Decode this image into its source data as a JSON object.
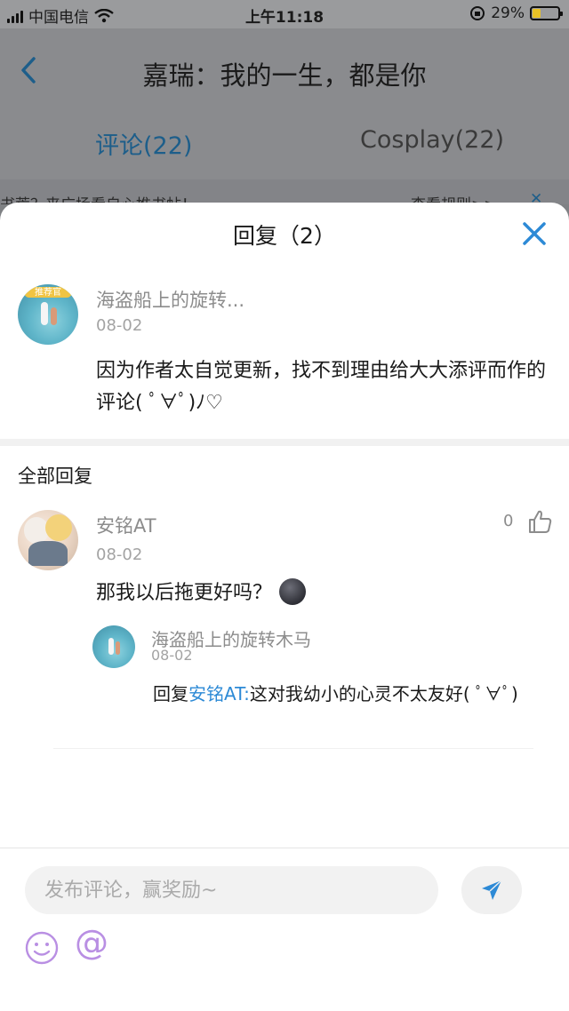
{
  "status_bar": {
    "carrier": "中国电信",
    "time": "上午11:18",
    "battery": "29%",
    "battery_level": 0.29
  },
  "header": {
    "title": "嘉瑞：我的一生，都是你"
  },
  "tabs": [
    {
      "label": "评论(22)",
      "active": true
    },
    {
      "label": "Cosplay(22)",
      "active": false
    }
  ],
  "banner": {
    "left_text": "书荒？来广场看自心推书帖！",
    "right_text": "查看规则>>"
  },
  "sheet": {
    "title": "回复（2）",
    "parent_comment": {
      "badge": "推荐官",
      "author": "海盗船上的旋转...",
      "date": "08-02",
      "text": "因为作者太自觉更新，找不到理由给大大添评而作的评论( ﾟ∀ﾟ)ﾉ♡"
    },
    "section_title": "全部回复",
    "replies": [
      {
        "author": "安铭AT",
        "date": "08-02",
        "likes": "0",
        "text": "那我以后拖更好吗？",
        "emoji_icon": "moon-emoji",
        "nested": {
          "author": "海盗船上的旋转木马",
          "date": "08-02",
          "prefix": "回复",
          "mention": "安铭AT:",
          "text": "这对我幼小的心灵不太友好( ﾟ∀ﾟ)"
        }
      }
    ]
  },
  "composer": {
    "placeholder": "发布评论，赢奖励~",
    "at_symbol": "@"
  },
  "colors": {
    "accent": "#2d8ad6",
    "at_purple": "#b98fe3"
  }
}
